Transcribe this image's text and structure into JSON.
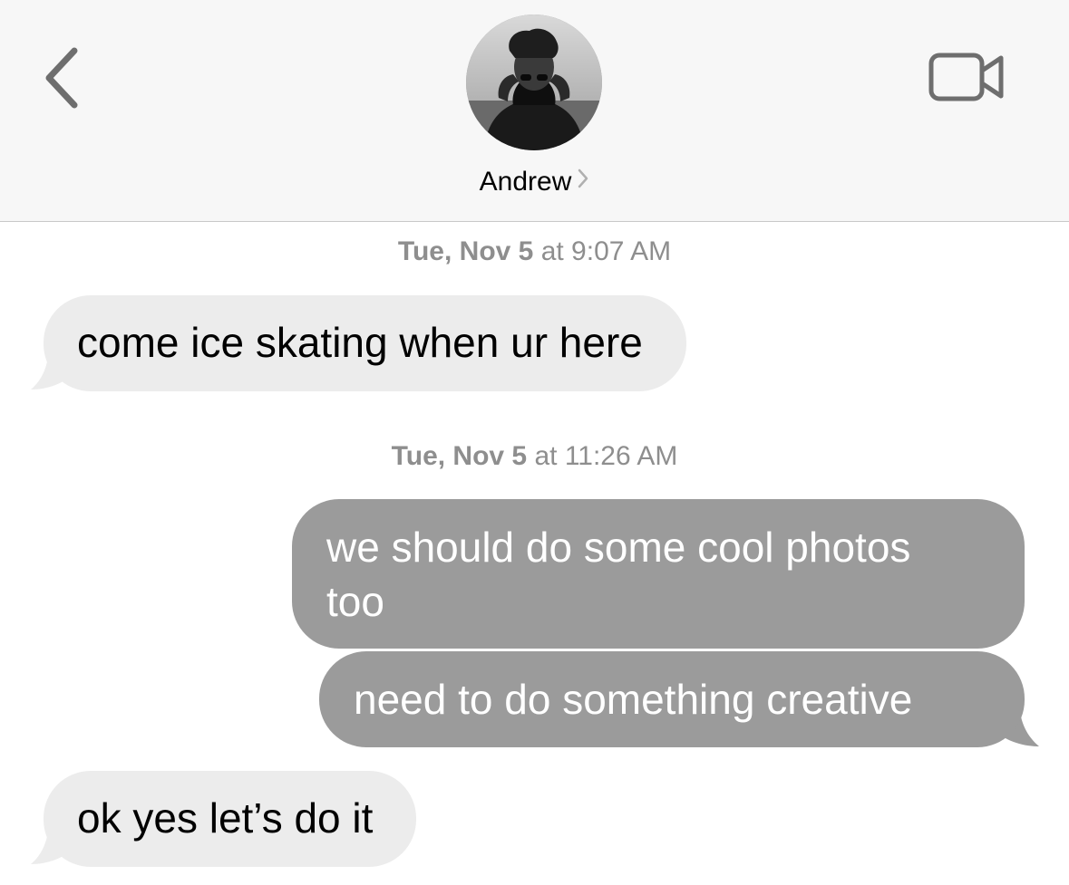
{
  "header": {
    "contact_name": "Andrew",
    "back_icon": "chevron-left-icon",
    "video_icon": "video-camera-icon"
  },
  "messages": {
    "timestamps": [
      {
        "day": "Tue, Nov 5",
        "time": " at 9:07 AM"
      },
      {
        "day": "Tue, Nov 5",
        "time": " at 11:26 AM"
      }
    ],
    "bubbles": [
      {
        "direction": "incoming",
        "text": "come ice skating when ur here"
      },
      {
        "direction": "outgoing",
        "line1": "we should do some cool photos",
        "line2": "too"
      },
      {
        "direction": "outgoing",
        "text": "need to do something creative"
      },
      {
        "direction": "incoming",
        "text": "ok yes let’s do it"
      }
    ]
  },
  "colors": {
    "incoming_bubble": "#ececec",
    "outgoing_bubble": "#9b9b9b",
    "timestamp_text": "#8e8e8e"
  }
}
